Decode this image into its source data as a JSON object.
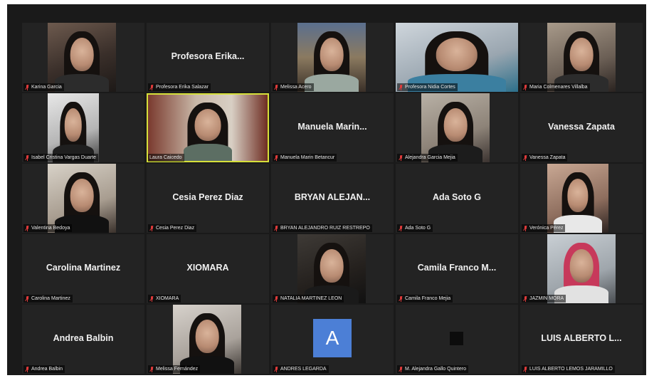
{
  "participants": [
    {
      "name": "Karina Garcia",
      "display": "",
      "video": true
    },
    {
      "name": "Profesora Erika Salazar",
      "display": "Profesora  Erika...",
      "video": false
    },
    {
      "name": "Melissa Acero",
      "display": "",
      "video": true
    },
    {
      "name": "Profesora Nidia Cortes",
      "display": "",
      "video": true
    },
    {
      "name": "Maria Colmenares Villalba",
      "display": "",
      "video": true
    },
    {
      "name": "Isabel Cristina Vargas Duarte",
      "display": "",
      "video": true
    },
    {
      "name": "Laura Caicedo",
      "display": "",
      "video": true,
      "active": true
    },
    {
      "name": "Manuela Marin Betancur",
      "display": "Manuela  Marin...",
      "video": false
    },
    {
      "name": "Alejandra Garcia Mejia",
      "display": "",
      "video": true
    },
    {
      "name": "Vanessa Zapata",
      "display": "Vanessa Zapata",
      "video": false
    },
    {
      "name": "Valentina Bedoya",
      "display": "",
      "video": true
    },
    {
      "name": "Cesia Perez Diaz",
      "display": "Cesia Perez Diaz",
      "video": false
    },
    {
      "name": "BRYAN ALEJANDRO RUIZ RESTREPO",
      "display": "BRYAN  ALEJAN...",
      "video": false
    },
    {
      "name": "Ada Soto G",
      "display": "Ada Soto G",
      "video": false
    },
    {
      "name": "Verónica Pérez",
      "display": "",
      "video": true
    },
    {
      "name": "Carolina Martinez",
      "display": "Carolina Martinez",
      "video": false
    },
    {
      "name": "XIOMARA",
      "display": "XIOMARA",
      "video": false
    },
    {
      "name": "NATALIA MARTINEZ LEON",
      "display": "",
      "video": true
    },
    {
      "name": "Camila Franco Mejia",
      "display": "Camila  Franco  M...",
      "video": false
    },
    {
      "name": "JAZMIN MORA",
      "display": "",
      "video": true
    },
    {
      "name": "Andrea Balbin",
      "display": "Andrea Balbin",
      "video": false
    },
    {
      "name": "Melissa Fernández",
      "display": "",
      "video": true
    },
    {
      "name": "ANDRES LEGARDA",
      "display": "",
      "video": false,
      "avatar": "A"
    },
    {
      "name": "M. Alejandra Gallo Quintero",
      "display": "",
      "video": false,
      "avatar": "square"
    },
    {
      "name": "LUIS ALBERTO LEMOS JARAMILLO",
      "display": "LUIS  ALBERTO  L...",
      "video": false
    }
  ],
  "icons": {
    "muted": "mic-muted-icon"
  },
  "colors": {
    "active_speaker": "#d6e03a",
    "tile_bg": "#232323",
    "mute_red": "#e03b3b",
    "avatar_blue": "#4c7fd6"
  }
}
